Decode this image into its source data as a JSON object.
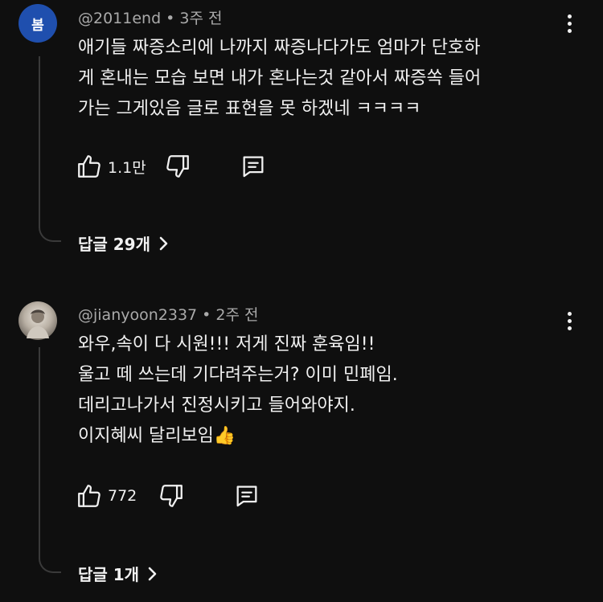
{
  "comments": [
    {
      "avatar_text": "봄",
      "author": "@2011end",
      "separator": "•",
      "time": "3주 전",
      "text": "애기들 짜증소리에 나까지 짜증나다가도 엄마가 단호하\n게 혼내는 모습 보면 내가 혼나는것 같아서 짜증쏙 들어\n가는 그게있음 글로 표현을 못 하겠네 ㅋㅋㅋㅋ",
      "likes": "1.1만",
      "replies_label": "답글 29개"
    },
    {
      "author": "@jianyoon2337",
      "separator": "•",
      "time": "2주 전",
      "text": "와우,속이  다  시원!!! 저게 진짜 훈육임!!\n울고 떼 쓰는데 기다려주는거? 이미 민폐임.\n데리고나가서 진정시키고 들어와야지.\n이지혜씨 달리보임👍",
      "likes": "772",
      "replies_label": "답글 1개"
    }
  ],
  "icons": {
    "like": "thumb-up-icon",
    "dislike": "thumb-down-icon",
    "reply": "reply-comment-icon",
    "more": "more-vertical-icon",
    "chevron": "chevron-right-icon"
  },
  "colors": {
    "background": "#0f0f0f",
    "text": "#f1f1f1",
    "meta": "#aaaaaa",
    "avatar": "#1f4fae",
    "thread_line": "#3a3a3a"
  }
}
